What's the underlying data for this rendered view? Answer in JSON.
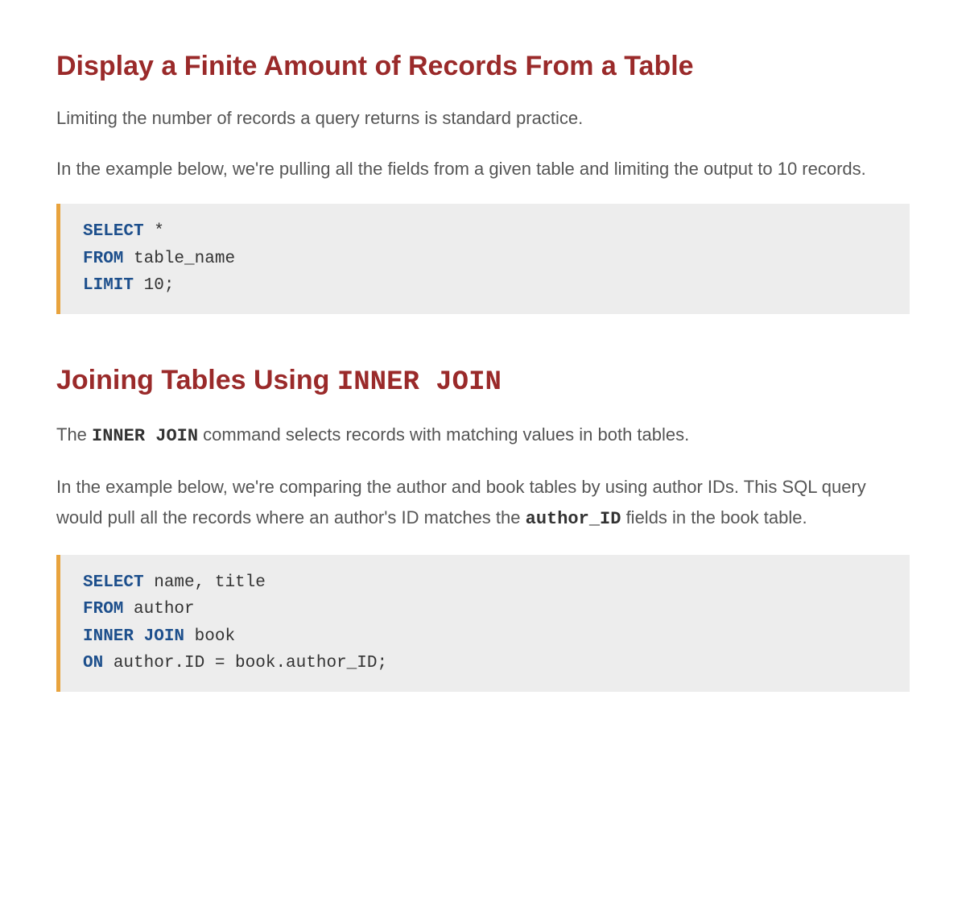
{
  "section1": {
    "heading": "Display a Finite Amount of Records From a Table",
    "para1": "Limiting the number of records a query returns is standard practice.",
    "para2": "In the example below, we're pulling all the fields from a given table and limiting the output to 10 records.",
    "code": {
      "line1_kw": "SELECT",
      "line1_rest": " *",
      "line2_kw": "FROM",
      "line2_rest": " table_name",
      "line3_kw": "LIMIT",
      "line3_rest": " 10;"
    }
  },
  "section2": {
    "heading_prefix": "Joining Tables Using ",
    "heading_mono": "INNER JOIN",
    "para1_prefix": "The ",
    "para1_mono": "INNER JOIN",
    "para1_suffix": " command selects records with matching values in both tables.",
    "para2_prefix": "In the example below, we're comparing the author and book tables by using author IDs. This SQL query would pull all the records where an author's ID matches the ",
    "para2_mono": "author_ID",
    "para2_suffix": " fields in the book table.",
    "code": {
      "line1_kw": "SELECT",
      "line1_rest": " name, title",
      "line2_kw": "FROM",
      "line2_rest": " author",
      "line3_kw": "INNER JOIN",
      "line3_rest": " book",
      "line4_kw": "ON",
      "line4_rest": " author.ID = book.author_ID;"
    }
  }
}
